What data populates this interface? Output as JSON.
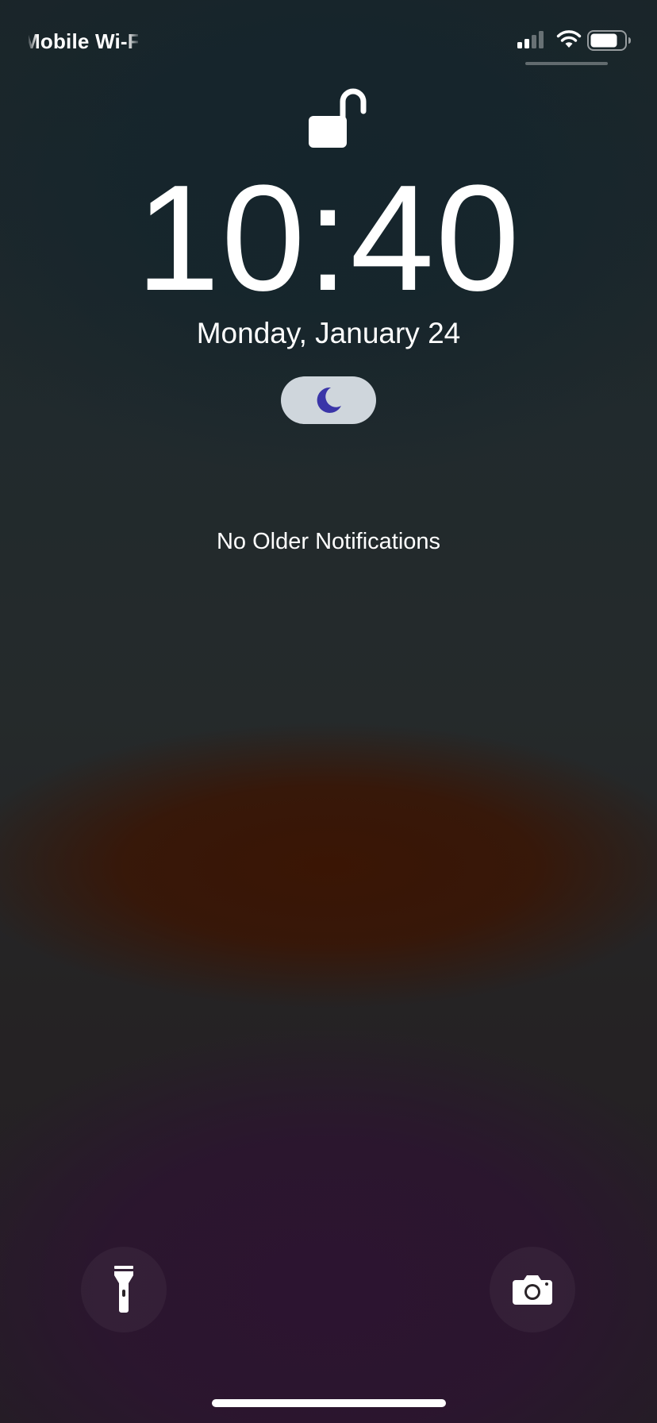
{
  "status_bar": {
    "carrier": "Mobile Wi-Fi",
    "signal_icon": "cellular-signal-icon",
    "wifi_icon": "wifi-icon",
    "battery_icon": "battery-icon",
    "battery_level": 0.8
  },
  "lock_screen": {
    "lock_icon": "unlocked-padlock-icon",
    "time": "10:40",
    "date": "Monday, January 24",
    "focus_icon": "moon-icon",
    "notifications_text": "No Older Notifications"
  },
  "quick_actions": {
    "flashlight_icon": "flashlight-icon",
    "camera_icon": "camera-icon"
  },
  "colors": {
    "focus_pill": "#cfd6dc",
    "moon": "#3a35a8"
  }
}
